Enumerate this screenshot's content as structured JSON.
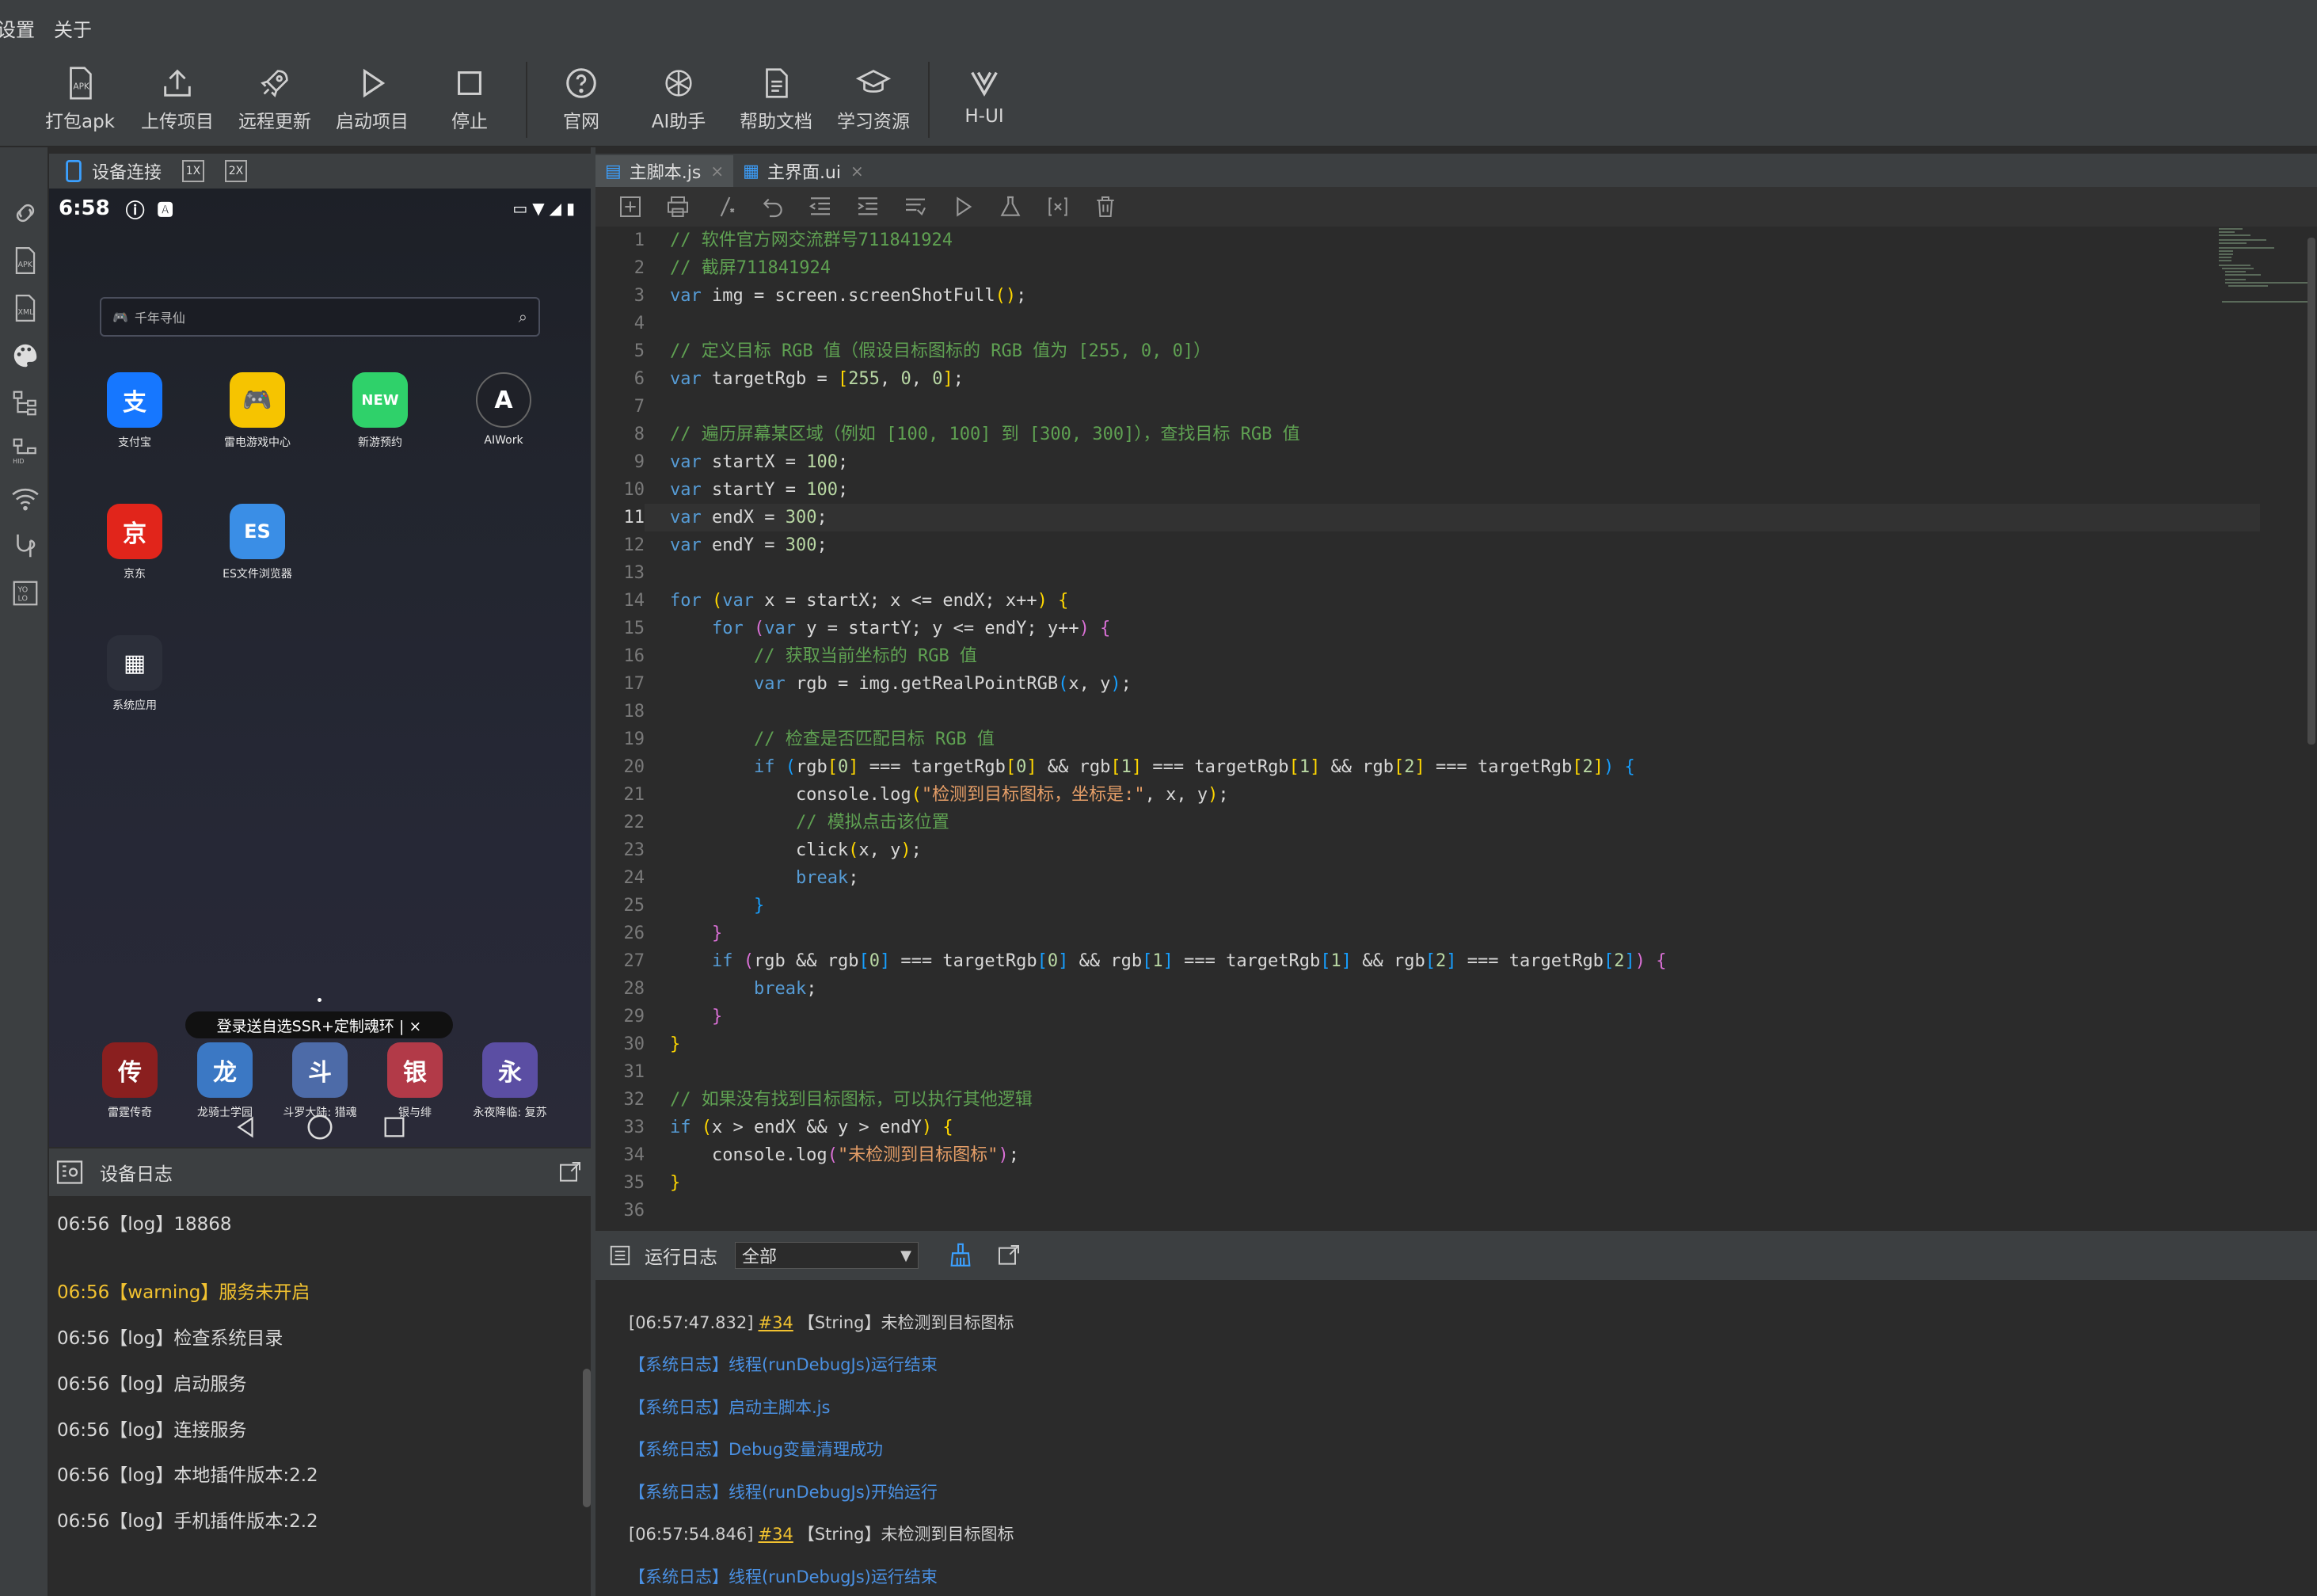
{
  "menu": {
    "items": [
      "设置",
      "关于"
    ]
  },
  "toolbar": {
    "items": [
      {
        "label": "打包apk",
        "icon": "apk-package-icon"
      },
      {
        "label": "上传项目",
        "icon": "upload-icon"
      },
      {
        "label": "远程更新",
        "icon": "rocket-icon"
      },
      {
        "label": "启动项目",
        "icon": "play-icon"
      },
      {
        "label": "停止",
        "icon": "stop-icon"
      },
      {
        "label": "官网",
        "icon": "help-circle-icon"
      },
      {
        "label": "AI助手",
        "icon": "ai-icon"
      },
      {
        "label": "帮助文档",
        "icon": "document-icon"
      },
      {
        "label": "学习资源",
        "icon": "graduation-cap-icon"
      },
      {
        "label": "H-UI",
        "icon": "h-ui-logo-icon"
      }
    ]
  },
  "device_panel": {
    "tab_label": "设备连接",
    "zoom1": "1X",
    "zoom2": "2X"
  },
  "phone": {
    "time": "6:58",
    "search_placeholder": "千年寻仙",
    "apps": [
      {
        "name": "支付宝",
        "glyph": "支",
        "color": "#1677ff"
      },
      {
        "name": "雷电游戏中心",
        "glyph": "🎮",
        "color": "#f6c400"
      },
      {
        "name": "新游预约",
        "glyph": "NEW",
        "color": "#2fd16a"
      },
      {
        "name": "AIWork",
        "glyph": "A",
        "color": "#1f2128"
      },
      {
        "name": "京东",
        "glyph": "京",
        "color": "#e1251b"
      },
      {
        "name": "ES文件浏览器",
        "glyph": "ES",
        "color": "#3a8ee6"
      },
      {
        "name": "系统应用",
        "glyph": "▦",
        "color": "#2c2f3a"
      }
    ],
    "promo": "登录送自选SSR+定制魂环 | ×",
    "dock": [
      {
        "name": "雷霆传奇",
        "glyph": "传",
        "color": "#8a1f1f"
      },
      {
        "name": "龙骑士学园",
        "glyph": "龙",
        "color": "#3b78c4"
      },
      {
        "name": "斗罗大陆: 猎魂",
        "glyph": "斗",
        "color": "#4d6ba8"
      },
      {
        "name": "银与绯",
        "glyph": "银",
        "color": "#b23a48"
      },
      {
        "name": "永夜降临: 复苏",
        "glyph": "永",
        "color": "#5b4ea3"
      }
    ]
  },
  "device_log": {
    "title": "设备日志",
    "lines": [
      {
        "text": "06:56【log】18868",
        "level": "log"
      },
      {
        "text": "06:56【warning】服务未开启",
        "level": "warning"
      },
      {
        "text": "06:56【log】检查系统目录",
        "level": "log"
      },
      {
        "text": "06:56【log】启动服务",
        "level": "log"
      },
      {
        "text": "06:56【log】连接服务",
        "level": "log"
      },
      {
        "text": "06:56【log】本地插件版本:2.2",
        "level": "log"
      },
      {
        "text": "06:56【log】手机插件版本:2.2",
        "level": "log"
      }
    ]
  },
  "editor": {
    "tabs": [
      {
        "label": "主脚本.js",
        "active": true
      },
      {
        "label": "主界面.ui",
        "active": false
      }
    ],
    "current_line": 11,
    "line_count": 36
  },
  "run_log": {
    "title": "运行日志",
    "filter": "全部",
    "lines": [
      {
        "kind": "string",
        "time": "[06:57:47.832]",
        "ref": "#34",
        "text": "【String】未检测到目标图标"
      },
      {
        "kind": "sys",
        "text": "【系统日志】线程(runDebugJs)运行结束"
      },
      {
        "kind": "sys",
        "text": "【系统日志】启动主脚本.js"
      },
      {
        "kind": "sys",
        "text": "【系统日志】Debug变量清理成功"
      },
      {
        "kind": "sys",
        "text": "【系统日志】线程(runDebugJs)开始运行"
      },
      {
        "kind": "string",
        "time": "[06:57:54.846]",
        "ref": "#34",
        "text": "【String】未检测到目标图标"
      },
      {
        "kind": "sys",
        "text": "【系统日志】线程(runDebugJs)运行结束"
      }
    ]
  }
}
